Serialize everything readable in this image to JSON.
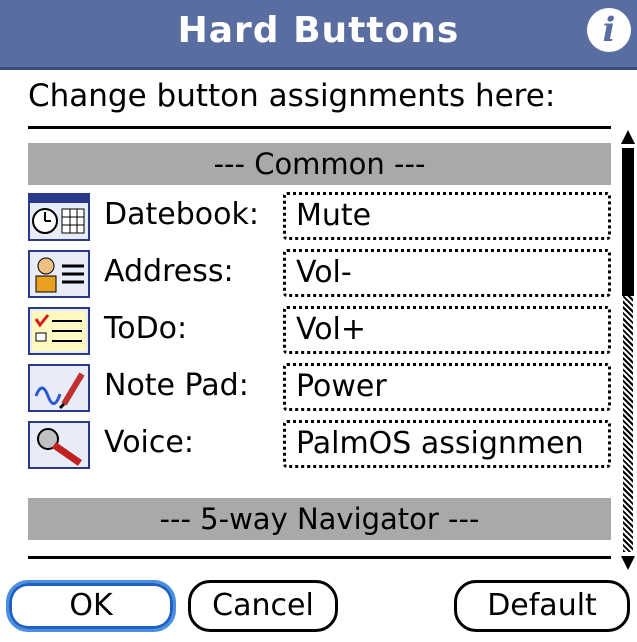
{
  "header": {
    "title": "Hard Buttons",
    "info_icon": "info-icon",
    "background": "#5a6da0"
  },
  "instruction": "Change button assignments here:",
  "sections": [
    {
      "header": "--- Common ---"
    },
    {
      "header": "--- 5-way Navigator ---"
    }
  ],
  "rows": [
    {
      "label": "Datebook:",
      "icon": "datebook-icon",
      "value": "Mute"
    },
    {
      "label": "Address:",
      "icon": "address-icon",
      "value": "Vol-"
    },
    {
      "label": "ToDo:",
      "icon": "todo-icon",
      "value": "Vol+"
    },
    {
      "label": "Note Pad:",
      "icon": "notepad-icon",
      "value": "Power"
    },
    {
      "label": "Voice:",
      "icon": "voice-icon",
      "value": "PalmOS assignmen"
    }
  ],
  "buttons": {
    "ok": "OK",
    "cancel": "Cancel",
    "default": "Default"
  },
  "colors": {
    "focus_ring": "#4a90e2",
    "section_bg": "#a9a9a9"
  }
}
